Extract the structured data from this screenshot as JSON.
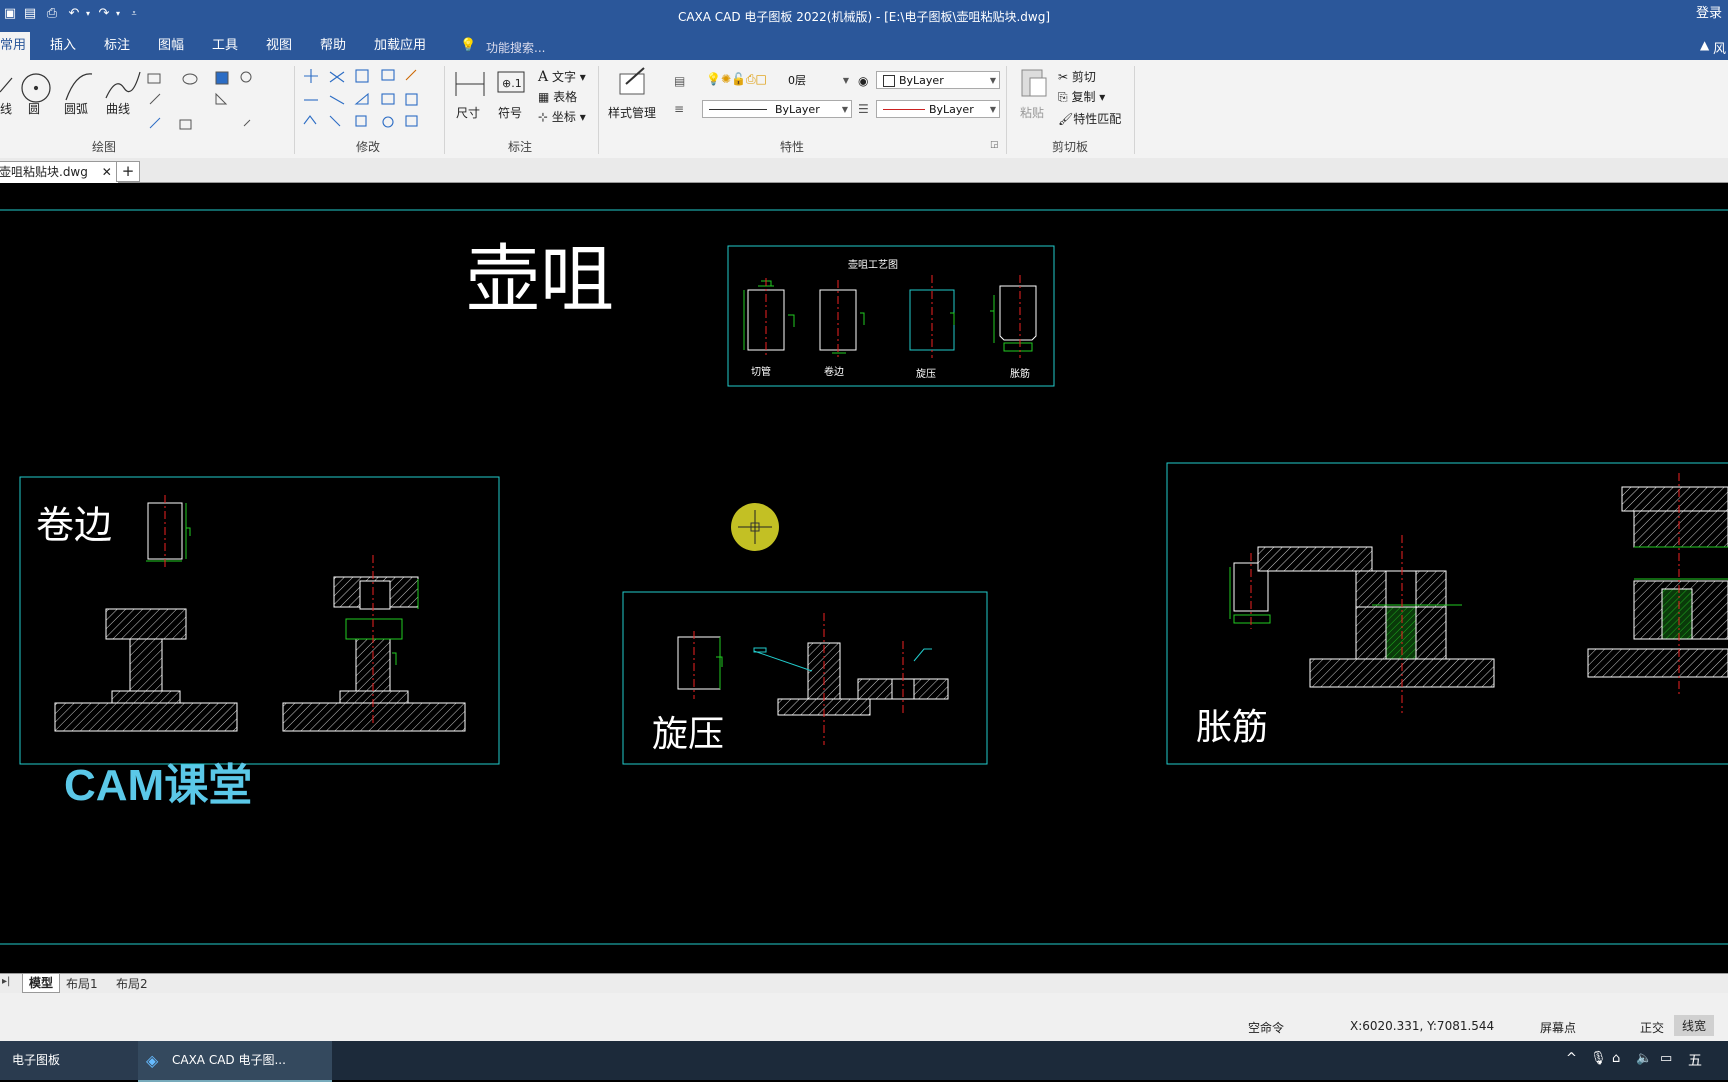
{
  "window": {
    "title": "CAXA CAD 电子图板 2022(机械版) - [E:\\电子图板\\壶咀粘贴块.dwg]",
    "login": "登录"
  },
  "ribbon_tabs": [
    "常用",
    "插入",
    "标注",
    "图幅",
    "工具",
    "视图",
    "帮助",
    "加载应用"
  ],
  "search_placeholder": "功能搜索...",
  "ribbon_right": "风",
  "draw_group": {
    "label": "绘图",
    "tools": [
      "线",
      "圆",
      "圆弧",
      "曲线"
    ]
  },
  "modify_group": {
    "label": "修改"
  },
  "annotate_group": {
    "label": "标注",
    "tools": [
      "尺寸",
      "符号",
      "文字",
      "表格",
      "坐标"
    ]
  },
  "props_group": {
    "label": "特性",
    "style_manager": "样式管理",
    "layer": "0层",
    "color": "ByLayer",
    "linetype": "ByLayer",
    "lineweight": "ByLayer"
  },
  "clipboard_group": {
    "label": "剪切板",
    "paste": "粘贴",
    "cut": "剪切",
    "copy": "复制",
    "match": "特性匹配"
  },
  "document_tab": "壶咀粘贴块.dwg",
  "drawing": {
    "main_title": "壶咀",
    "process_title": "壶咀工艺图",
    "process_steps": [
      "切管",
      "卷边",
      "旋压",
      "胀筋"
    ],
    "section_curl": "卷边",
    "section_spin": "旋压",
    "section_bulge": "胀筋",
    "watermark": "CAM课堂"
  },
  "layout_tabs": [
    "模型",
    "布局1",
    "布局2"
  ],
  "status": {
    "command": "空命令",
    "coords": "X:6020.331, Y:7081.544",
    "snap": "屏幕点",
    "ortho": "正交",
    "lineweight": "线宽"
  },
  "taskbar": {
    "item1": "电子图板",
    "item2": "CAXA CAD 电子图...",
    "ime": "五"
  }
}
